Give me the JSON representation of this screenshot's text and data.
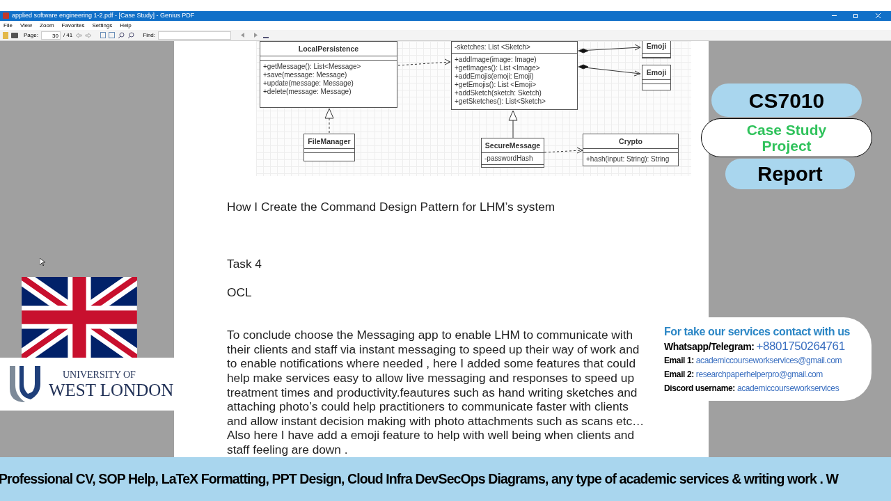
{
  "window": {
    "title": "applied  software engineering 1-2.pdf - [Case Study] - Genius PDF"
  },
  "menu": [
    "File",
    "View",
    "Zoom",
    "Favorites",
    "Settings",
    "Help"
  ],
  "toolbar": {
    "page_label": "Page:",
    "page": "30",
    "page_total": "/ 41",
    "find_label": "Find:"
  },
  "diagram": {
    "classes": [
      {
        "name": "LocalPersistence",
        "methods": [
          "+getMessage(): List<Message>",
          "+save(message: Message)",
          "+update(message: Message)",
          "+delete(message: Message)"
        ]
      },
      {
        "attributes": [
          "-sketches: List <Sketch>"
        ],
        "methods": [
          "+addImage(image: Image)",
          "+getImages(): List <Image>",
          "+addEmojis(emoji: Emoji)",
          "+getEmojis(): List <Emoji>",
          "+addSketch(sketch: Sketch)",
          "+getSketches(): List<Sketch>"
        ]
      },
      {
        "name": "Emoji"
      },
      {
        "name": "Emoji"
      },
      {
        "name": "FileManager"
      },
      {
        "name": "SecureMessage",
        "attributes": [
          "-passwordHash"
        ]
      },
      {
        "name": "Crypto",
        "methods": [
          "+hash(input: String): String"
        ]
      }
    ]
  },
  "document": {
    "heading": "How I Create the Command Design Pattern for LHM’s system",
    "task": "Task 4",
    "subheading": "OCL",
    "paragraph": "To conclude  choose the Messaging app to enable LHM to communicate with\ntheir clients and staff via instant messaging to speed up their way of work and\nto enable notifications where needed , here I added some features that could\nhelp make services easy to allow live messaging and responses to speed up\ntreatment times and productivity.feautures such as hand writing sketches and\nattaching photo’s  could help  practitioners  to communicate faster  with clients\nand allow instant decision making  with photo attachments such as scans etc…\nAlso here I have add a emoji feature to help with well being when clients and\nstaff feeling are down ."
  },
  "badges": {
    "course": "CS7010",
    "project": "Case Study Project",
    "report": "Report"
  },
  "university": {
    "line1": "UNIVERSITY OF",
    "line2": "WEST LONDON"
  },
  "contact": {
    "title": "For take our services contact with us",
    "rows": [
      {
        "label": "Whatsapp/Telegram:",
        "value": "+8801750264761"
      },
      {
        "label": "Email 1:",
        "value": "academiccourseworkservices@gmail.com"
      },
      {
        "label": "Email 2:",
        "value": "researchpaperhelperpro@gmail.com"
      },
      {
        "label": "Discord username:",
        "value": "academiccourseworkservices"
      }
    ]
  },
  "banner": "Professional CV,  SOP Help,  LaTeX Formatting, PPT Design, Cloud Infra  DevSecOps Diagrams,  any type of academic services & writing work . W"
}
